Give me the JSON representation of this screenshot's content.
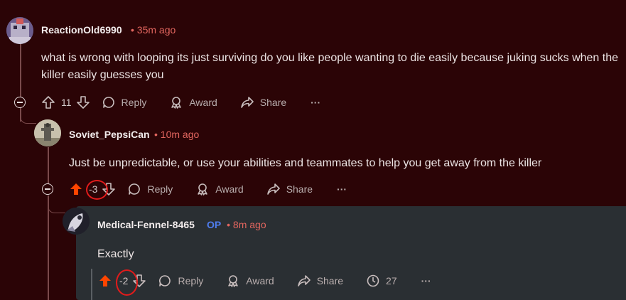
{
  "comments": [
    {
      "username": "ReactionOld6990",
      "timestamp": "35m ago",
      "text": "what is wrong with looping its just surviving do you like people wanting to die easily because juking sucks when the killer easily guesses you",
      "score": "11",
      "actions": {
        "reply": "Reply",
        "award": "Award",
        "share": "Share",
        "more": "···"
      }
    },
    {
      "username": "Soviet_PepsiCan",
      "timestamp": "10m ago",
      "text": "Just be unpredictable, or use your abilities and teammates to help you get away from the killer",
      "score": "-3",
      "actions": {
        "reply": "Reply",
        "award": "Award",
        "share": "Share",
        "more": "···"
      }
    },
    {
      "username": "Medical-Fennel-8465",
      "op_badge": "OP",
      "timestamp": "8m ago",
      "text": "Exactly",
      "score": "-2",
      "actions": {
        "reply": "Reply",
        "award": "Award",
        "share": "Share",
        "views": "27",
        "more": "···"
      }
    }
  ],
  "meta_separator": "•",
  "colors": {
    "upvote_active": "#ff4500",
    "op": "#4f7df0",
    "annotation_circle": "#e21b1b"
  },
  "icons": [
    "upvote-icon",
    "downvote-icon",
    "reply-icon",
    "award-icon",
    "share-icon",
    "clock-icon",
    "more-icon",
    "collapse-icon"
  ]
}
